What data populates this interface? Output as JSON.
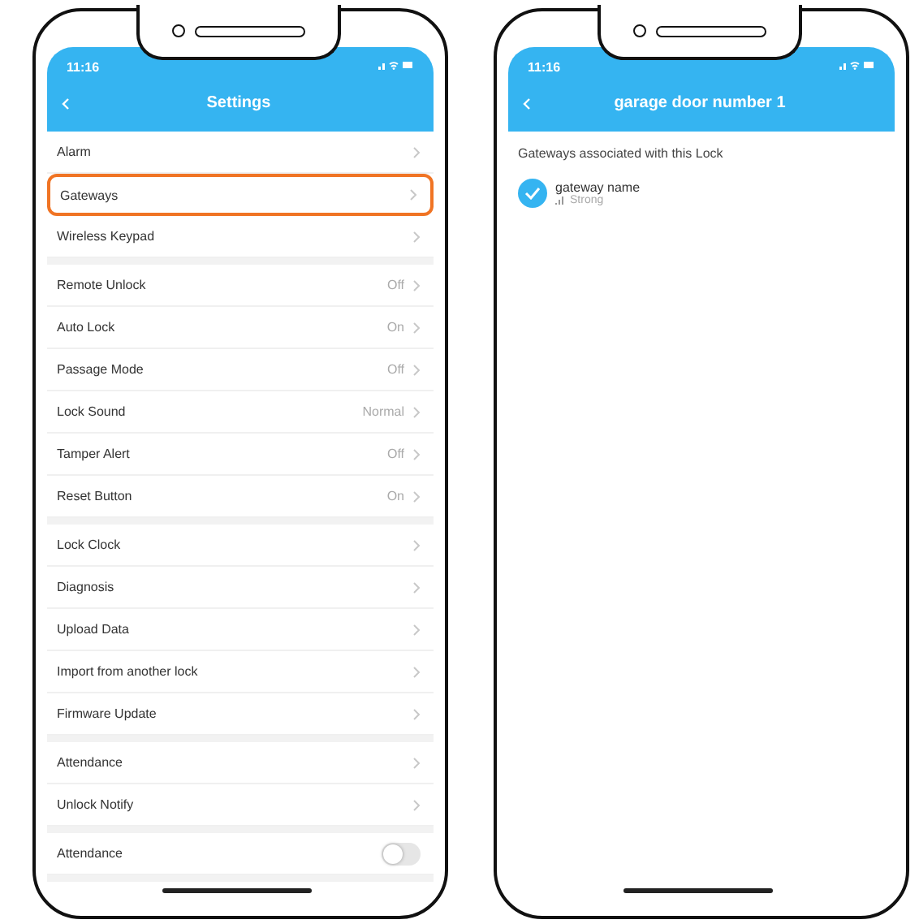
{
  "phones": [
    {
      "kind": "settings",
      "status_time": "11:16",
      "title": "Settings",
      "groups": [
        [
          {
            "label": "Alarm",
            "kind": "link",
            "highlighted": false
          },
          {
            "label": "Gateways",
            "kind": "link",
            "highlighted": true
          },
          {
            "label": "Wireless Keypad",
            "kind": "link",
            "highlighted": false
          }
        ],
        [
          {
            "label": "Remote Unlock",
            "kind": "link",
            "value": "Off",
            "highlighted": false
          },
          {
            "label": "Auto Lock",
            "kind": "link",
            "value": "On",
            "highlighted": false
          },
          {
            "label": "Passage Mode",
            "kind": "link",
            "value": "Off",
            "highlighted": false
          },
          {
            "label": "Lock Sound",
            "kind": "link",
            "value": "Normal",
            "highlighted": false
          },
          {
            "label": "Tamper Alert",
            "kind": "link",
            "value": "Off",
            "highlighted": false
          },
          {
            "label": "Reset Button",
            "kind": "link",
            "value": "On",
            "highlighted": false
          }
        ],
        [
          {
            "label": "Lock Clock",
            "kind": "link",
            "highlighted": false
          },
          {
            "label": "Diagnosis",
            "kind": "link",
            "highlighted": false
          },
          {
            "label": "Upload Data",
            "kind": "link",
            "highlighted": false
          },
          {
            "label": "Import from another lock",
            "kind": "link",
            "highlighted": false
          },
          {
            "label": "Firmware Update",
            "kind": "link",
            "highlighted": false
          }
        ],
        [
          {
            "label": "Attendance",
            "kind": "link",
            "highlighted": false
          },
          {
            "label": "Unlock Notify",
            "kind": "link",
            "highlighted": false
          }
        ],
        [
          {
            "label": "Attendance",
            "kind": "toggle",
            "on": false,
            "highlighted": false
          }
        ]
      ]
    },
    {
      "kind": "detail",
      "status_time": "11:16",
      "title": "garage door number 1",
      "caption": "Gateways associated with this Lock",
      "gateways": [
        {
          "name": "gateway name",
          "signal": "Strong"
        }
      ]
    }
  ]
}
